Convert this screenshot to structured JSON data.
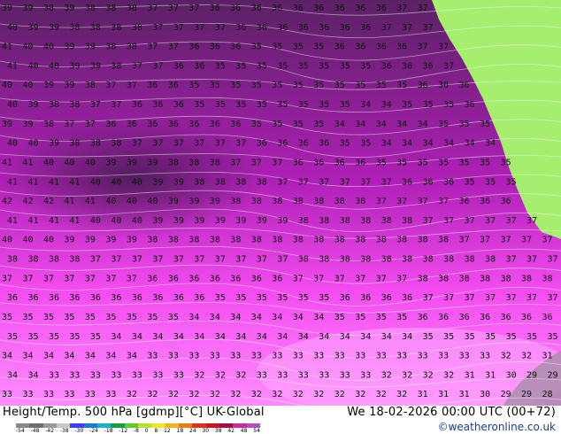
{
  "product": "Height/Temp. 500 hPa [gdmp][°C] UK-Global",
  "valid_time": "We 18-02-2026 00:00 UTC (00+72)",
  "credit": "©weatheronline.co.uk",
  "scale": {
    "labels": [
      "-54",
      "-48",
      "-42",
      "-38",
      "-30",
      "-24",
      "-18",
      "-12",
      "-8",
      "0",
      "8",
      "12",
      "18",
      "24",
      "30",
      "38",
      "42",
      "48",
      "54"
    ],
    "colors": [
      "#8a8a8a",
      "#6e6e6e",
      "#9a9a9a",
      "#c8c8c8",
      "#3d3dff",
      "#1c7ad6",
      "#13b3c9",
      "#10a040",
      "#5ccd2b",
      "#b6e22c",
      "#f0e81e",
      "#f2b41a",
      "#ef7a14",
      "#e3311a",
      "#c9151b",
      "#a30c4a",
      "#cc2a9e",
      "#b052c4"
    ]
  },
  "map": {
    "land_color": "#a6ee6e",
    "sea_colors": [
      "#5a2164",
      "#b020b8",
      "#f44cf0",
      "#ff8cff"
    ],
    "contour_color": "#f3f3f3",
    "label_rows": [
      "39 39 38 39 38 38 38 37 37 37 36 36 36 36 36 36 36 36 36 37 37 37 37 38 38 38 39",
      "40 39 39 38 38 38 38 37 37 37 37 36 36 36 36 36 36 36 37 37 37 37 38 38 38 39 40",
      "41 40 40 39 39 38 38 37 37 36 36 36 35 35 35 35 36 36 36 36 37 37 37 38 38 39 39",
      "41 40 40 39 39 38 37 37 36 36 35 35 35 35 35 35 35 35 36 36 36 37 37 38 38 38 39",
      "40 40 39 39 38 37 37 36 36 35 35 35 35 35 35 35 35 35 35 35 36 36 36 37 37 38 38",
      "40 39 38 38 37 37 36 36 36 35 35 35 35 35 35 35 35 34 34 35 35 35 36 36 37 37 37",
      "39 39 38 37 37 36 36 36 36 36 36 36 35 35 35 35 34 34 34 34 34 35 35 35 36 36 36",
      "40 40 39 38 38 38 37 37 37 37 37 37 36 36 36 36 35 35 34 34 34 34 34 34 35 35 35",
      "41 41 40 40 40 39 39 39 38 38 38 37 37 37 36 36 36 36 35 35 35 35 35 35 35 35 35",
      "41 41 41 41 40 40 40 39 39 38 38 38 38 37 37 37 37 37 37 36 36 36 35 35 35 35 35",
      "42 42 42 41 41 40 40 40 39 39 39 38 38 38 38 38 38 38 37 37 37 37 36 36 36 36 36",
      "41 41 41 41 40 40 40 39 39 39 39 39 39 39 38 38 38 38 38 38 37 37 37 37 37 37 37",
      "40 40 40 39 39 39 39 38 38 38 38 38 38 38 38 38 38 38 38 38 38 38 37 37 37 37 37",
      "38 38 38 38 37 37 37 37 37 37 37 37 37 37 38 38 38 38 38 38 38 38 38 38 37 37 37",
      "37 37 37 37 37 37 37 36 36 36 36 36 36 36 37 37 37 37 37 37 38 38 38 38 38 38 38",
      "36 36 36 36 36 36 36 36 36 36 35 35 35 35 35 35 36 36 36 36 37 37 37 37 37 37 37",
      "35 35 35 35 35 35 35 35 35 34 34 34 34 34 34 34 35 35 35 35 36 36 36 36 36 36 36",
      "35 35 35 35 35 34 34 34 34 34 34 34 34 34 34 34 34 34 34 34 35 35 35 35 35 35 35",
      "34 34 34 34 34 34 34 33 33 33 33 33 33 33 33 33 33 33 33 33 33 33 33 33 32 32 31",
      "34 34 33 33 33 33 33 33 33 32 32 32 33 33 33 33 33 33 32 32 32 32 31 31 30 29 29",
      "33 33 33 33 33 33 32 32 32 32 32 32 32 32 32 32 32 32 32 32 31 31 31 30 29 29 28"
    ]
  }
}
